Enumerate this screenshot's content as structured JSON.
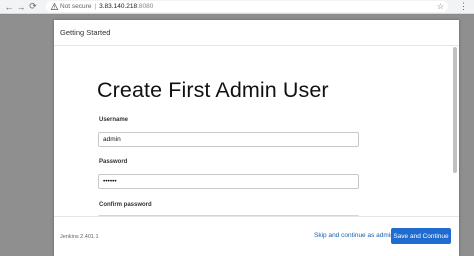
{
  "browser": {
    "security_label": "Not secure",
    "url_host": "3.83.140.218",
    "url_port": ":8080",
    "icons": [
      "back-icon",
      "forward-icon",
      "reload-icon",
      "warning-icon",
      "star-icon",
      "menu-icon"
    ]
  },
  "dialog": {
    "header_title": "Getting Started",
    "page_title": "Create First Admin User",
    "fields": {
      "username": {
        "label": "Username",
        "value": "admin"
      },
      "password": {
        "label": "Password",
        "value": "••••••"
      },
      "confirm": {
        "label": "Confirm password",
        "value": "••••••"
      }
    },
    "footer": {
      "version": "Jenkins 2.401.1",
      "skip_label": "Skip and continue as admin",
      "save_label": "Save and Continue"
    }
  },
  "colors": {
    "accent": "#1f6bd0",
    "link": "#1a5fa8"
  }
}
